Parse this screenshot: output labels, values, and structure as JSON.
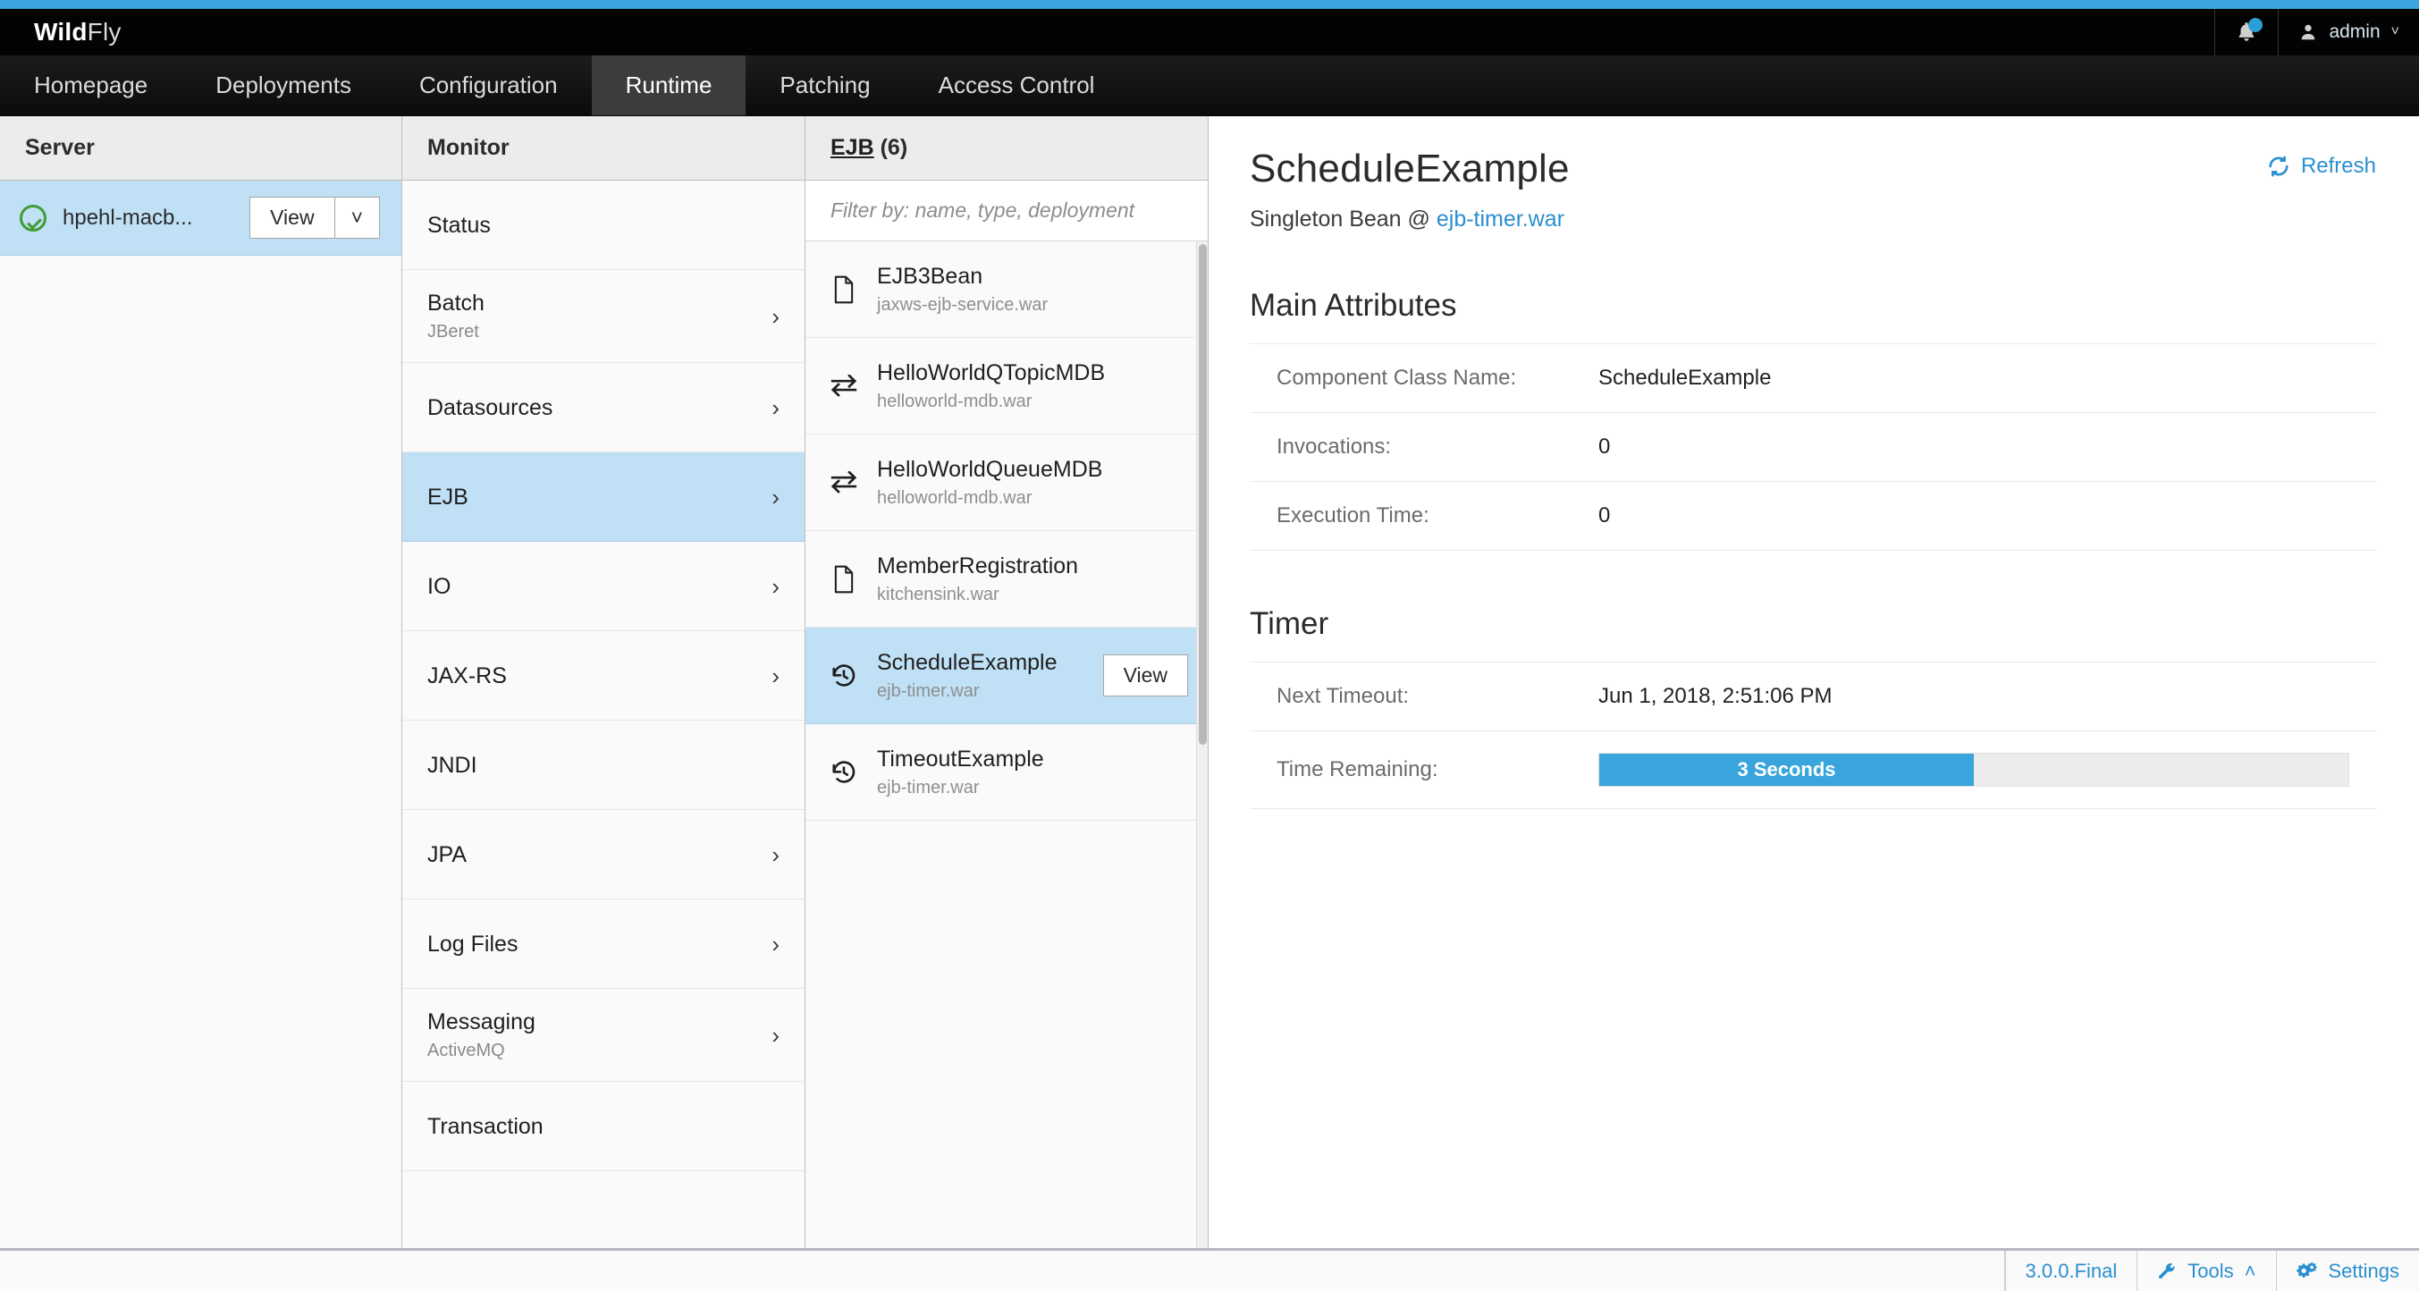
{
  "app": {
    "brand_bold": "Wild",
    "brand_light": "Fly",
    "accent_color": "#39a5dc",
    "link_color": "#2a8fd0",
    "selected_row_color": "#bfe0f5",
    "active_tab_color": "#3c3c3c"
  },
  "topbar": {
    "notifications_icon": "bell-icon",
    "notification_badge": "",
    "user_icon": "user-icon",
    "user_label": "admin",
    "user_chevron": "˅"
  },
  "nav": {
    "items": [
      {
        "label": "Homepage",
        "active": false
      },
      {
        "label": "Deployments",
        "active": false
      },
      {
        "label": "Configuration",
        "active": false
      },
      {
        "label": "Runtime",
        "active": true
      },
      {
        "label": "Patching",
        "active": false
      },
      {
        "label": "Access Control",
        "active": false
      }
    ]
  },
  "server_column": {
    "header": "Server",
    "rows": [
      {
        "status_icon": "check-circle-icon",
        "name": "hpehl-macb...",
        "view_label": "View",
        "dropdown_caret": "˅",
        "selected": true
      }
    ]
  },
  "monitor_column": {
    "header": "Monitor",
    "items": [
      {
        "label": "Status",
        "sub": "",
        "chevron": false,
        "selected": false
      },
      {
        "label": "Batch",
        "sub": "JBeret",
        "chevron": true,
        "selected": false
      },
      {
        "label": "Datasources",
        "sub": "",
        "chevron": true,
        "selected": false
      },
      {
        "label": "EJB",
        "sub": "",
        "chevron": true,
        "selected": true
      },
      {
        "label": "IO",
        "sub": "",
        "chevron": true,
        "selected": false
      },
      {
        "label": "JAX-RS",
        "sub": "",
        "chevron": true,
        "selected": false
      },
      {
        "label": "JNDI",
        "sub": "",
        "chevron": false,
        "selected": false
      },
      {
        "label": "JPA",
        "sub": "",
        "chevron": true,
        "selected": false
      },
      {
        "label": "Log Files",
        "sub": "",
        "chevron": true,
        "selected": false
      },
      {
        "label": "Messaging",
        "sub": "ActiveMQ",
        "chevron": true,
        "selected": false
      },
      {
        "label": "Transaction",
        "sub": "",
        "chevron": false,
        "selected": false
      }
    ]
  },
  "ejb_column": {
    "header_link": "EJB",
    "header_count": "(6)",
    "filter_placeholder": "Filter by: name, type, deployment",
    "filter_value": "",
    "items": [
      {
        "name": "EJB3Bean",
        "deployment": "jaxws-ejb-service.war",
        "icon": "document-icon",
        "selected": false,
        "action_label": ""
      },
      {
        "name": "HelloWorldQTopicMDB",
        "deployment": "helloworld-mdb.war",
        "icon": "exchange-icon",
        "selected": false,
        "action_label": ""
      },
      {
        "name": "HelloWorldQueueMDB",
        "deployment": "helloworld-mdb.war",
        "icon": "exchange-icon",
        "selected": false,
        "action_label": ""
      },
      {
        "name": "MemberRegistration",
        "deployment": "kitchensink.war",
        "icon": "document-icon",
        "selected": false,
        "action_label": ""
      },
      {
        "name": "ScheduleExample",
        "deployment": "ejb-timer.war",
        "icon": "history-icon",
        "selected": true,
        "action_label": "View"
      },
      {
        "name": "TimeoutExample",
        "deployment": "ejb-timer.war",
        "icon": "history-icon",
        "selected": false,
        "action_label": ""
      }
    ]
  },
  "detail": {
    "title": "ScheduleExample",
    "subtitle_prefix": "Singleton Bean @ ",
    "subtitle_link": "ejb-timer.war",
    "refresh_label": "Refresh",
    "refresh_icon": "refresh-icon",
    "sections": [
      {
        "title": "Main Attributes",
        "rows": [
          {
            "label": "Component Class Name:",
            "value": "ScheduleExample"
          },
          {
            "label": "Invocations:",
            "value": "0"
          },
          {
            "label": "Execution Time:",
            "value": "0"
          }
        ]
      },
      {
        "title": "Timer",
        "rows": [
          {
            "label": "Next Timeout:",
            "value": "Jun 1, 2018, 2:51:06 PM"
          }
        ],
        "progress": {
          "label": "Time Remaining:",
          "value_text": "3 Seconds",
          "percent": 50
        }
      }
    ]
  },
  "footer": {
    "version": "3.0.0.Final",
    "tools_icon": "wrench-icon",
    "tools_label": "Tools",
    "tools_caret": "˄",
    "settings_icon": "gears-icon",
    "settings_label": "Settings"
  }
}
